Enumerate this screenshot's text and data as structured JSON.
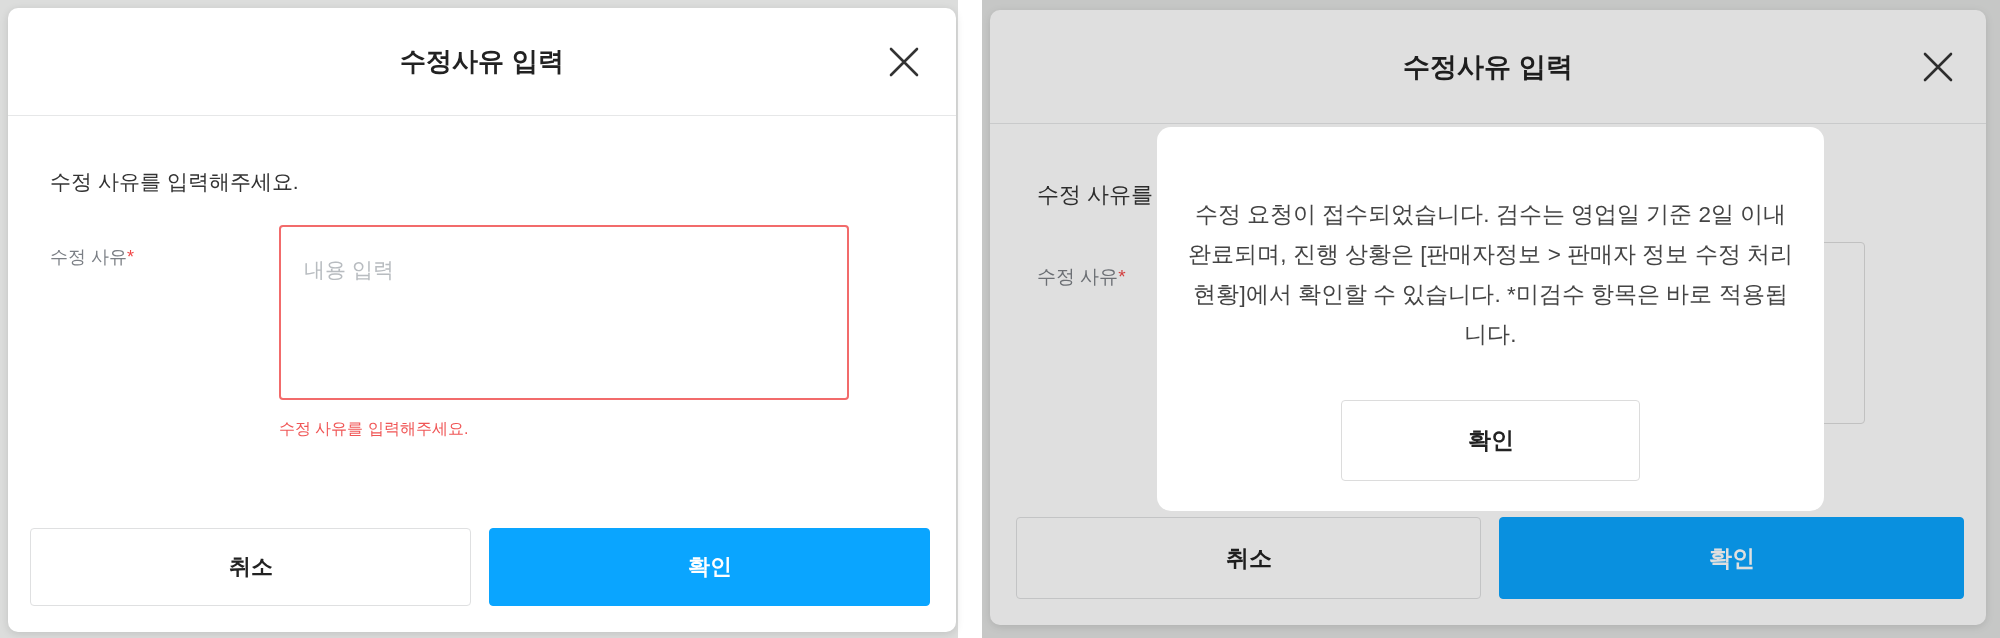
{
  "screens": [
    {
      "dimmed": false,
      "dialog": {
        "title": "수정사유 입력",
        "instruction": "수정 사유를 입력해주세요.",
        "field": {
          "label": "수정 사유",
          "required_mark": "*",
          "invalid": true,
          "placeholder": "내용 입력",
          "error": "수정 사유를 입력해주세요."
        },
        "buttons": [
          {
            "label": "취소",
            "kind": "secondary"
          },
          {
            "label": "확인",
            "kind": "primary"
          }
        ]
      }
    },
    {
      "dimmed": true,
      "dialog": {
        "title": "수정사유 입력",
        "instruction": "수정 사유를",
        "field": {
          "label": "수정 사유",
          "required_mark": "*",
          "invalid": false
        },
        "buttons": [
          {
            "label": "취소",
            "kind": "secondary"
          },
          {
            "label": "확인",
            "kind": "primary"
          }
        ]
      },
      "alert": {
        "message": "수정 요청이 접수되었습니다. 검수는 영업일 기준 2일 이내 완료되며, 진행 상황은 [판매자정보 > 판매자 정보 수정 처리 현황]에서 확인할 수 있습니다. *미검수 항목은 바로 적용됩니다.",
        "button": "확인"
      }
    }
  ]
}
